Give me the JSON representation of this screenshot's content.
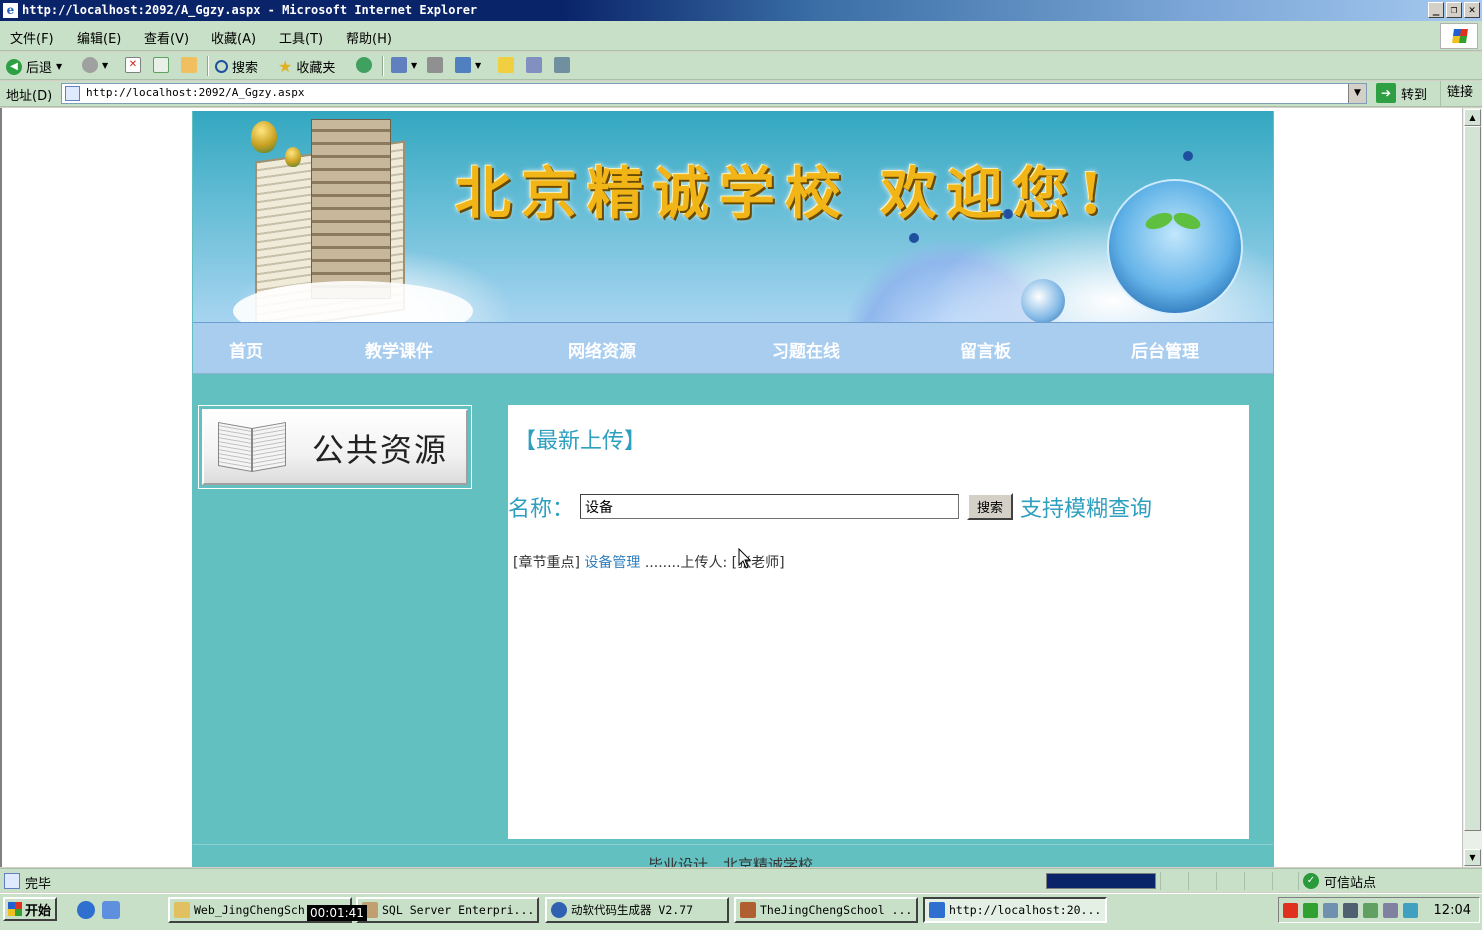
{
  "window": {
    "title": "http://localhost:2092/A_Ggzy.aspx - Microsoft Internet Explorer",
    "buttons": {
      "minimize": "_",
      "restore": "❐",
      "close": "✕"
    }
  },
  "menu": [
    "文件(F)",
    "编辑(E)",
    "查看(V)",
    "收藏(A)",
    "工具(T)",
    "帮助(H)"
  ],
  "toolbar": {
    "back": "后退",
    "search": "搜索",
    "favorites": "收藏夹"
  },
  "address": {
    "label": "地址(D)",
    "url": "http://localhost:2092/A_Ggzy.aspx",
    "go": "转到",
    "links": "链接"
  },
  "site": {
    "banner_title": "北京精诚学校 欢迎您!",
    "nav": [
      "首页",
      "教学课件",
      "网络资源",
      "习题在线",
      "留言板",
      "后台管理"
    ],
    "sidebar_title": "公共资源",
    "latest_heading": "【最新上传】",
    "search": {
      "label": "名称：",
      "value": "设备",
      "button": "搜索",
      "hint": "支持模糊查询"
    },
    "result": {
      "category": "[章节重点]",
      "title": "设备管理",
      "uploader_prefix": "........上传人:",
      "uploader": "[张老师]"
    },
    "footer": "毕业设计，北京精诚学校"
  },
  "status": {
    "text": "完毕",
    "zone": "可信站点"
  },
  "taskbar": {
    "start": "开始",
    "tasks": [
      "Web_JingChengSch...",
      "SQL Server Enterpri...",
      "动软代码生成器  V2.77",
      "TheJingChengSchool ...",
      "http://localhost:20..."
    ],
    "timer": "00:01:41",
    "clock": "12:04"
  }
}
